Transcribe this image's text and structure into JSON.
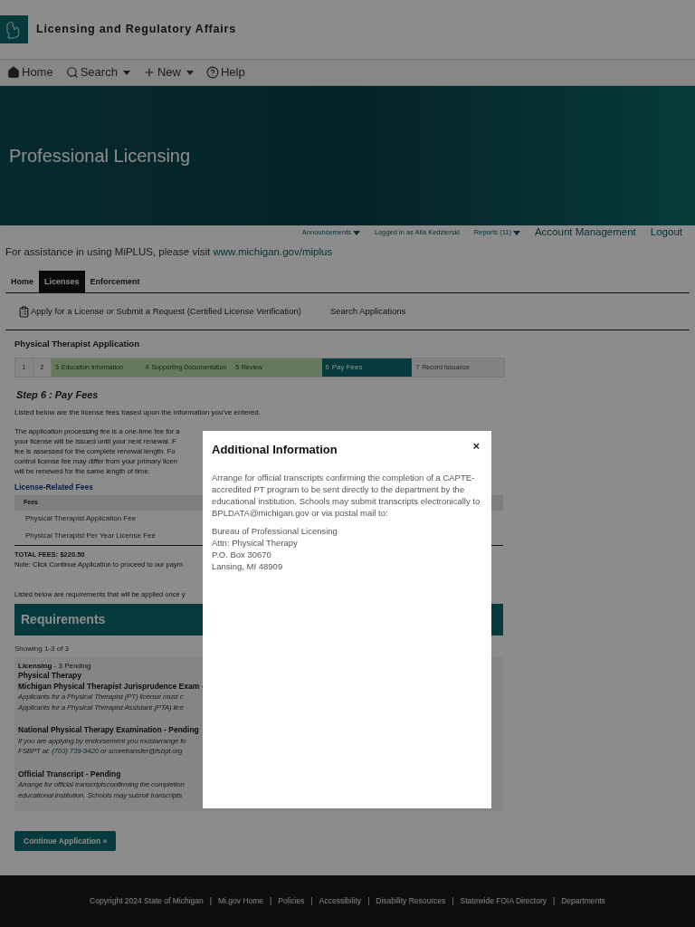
{
  "header": {
    "title": "Licensing and Regulatory Affairs"
  },
  "nav": [
    {
      "label": "Home",
      "kind": "home",
      "dropdown": false
    },
    {
      "label": "Search",
      "kind": "search",
      "dropdown": true
    },
    {
      "label": "New",
      "kind": "plus",
      "dropdown": true
    },
    {
      "label": "Help",
      "kind": "help",
      "dropdown": false
    }
  ],
  "banner": {
    "title": "Professional Licensing"
  },
  "utility_bar": [
    {
      "label": "Announcements",
      "kind": "small",
      "dropdown": true
    },
    {
      "label": "Logged in as Alla Kedzierski",
      "kind": "small",
      "dropdown": false
    },
    {
      "label": "Reports (11)",
      "kind": "small",
      "dropdown": true
    },
    {
      "label": "Account Management",
      "kind": "large",
      "dropdown": false
    },
    {
      "label": "Logout",
      "kind": "large",
      "dropdown": false
    }
  ],
  "assistance": {
    "text": "For assistance in using MiPLUS, please visit",
    "link": "www.michigan.gov/miplus"
  },
  "tabs": [
    {
      "label": "Home",
      "selected": false
    },
    {
      "label": "Licenses",
      "selected": true
    },
    {
      "label": "Enforcement",
      "selected": false
    }
  ],
  "submenu": [
    {
      "label": "Apply for a License or Submit a Request (Certified License Verification)",
      "kind": "clipboard"
    },
    {
      "label": "Search Applications",
      "kind": "plain"
    }
  ],
  "application": {
    "title": "Physical Therapist Application",
    "steps": [
      {
        "number": "1",
        "kind": "collapsed"
      },
      {
        "number": "2",
        "kind": "collapsed"
      },
      {
        "number": "3",
        "label": "Education Information",
        "kind": "done"
      },
      {
        "number": "4",
        "label": "Supporting Documentation",
        "kind": "done"
      },
      {
        "number": "5",
        "label": "Review",
        "kind": "done"
      },
      {
        "number": "6",
        "label": "Pay Fees",
        "kind": "current"
      },
      {
        "number": "7",
        "label": "Record Issuance",
        "kind": "upcoming"
      }
    ]
  },
  "step_heading": "Step 6 : Pay Fees",
  "fees_intro": "Listed below are the license fees based upon the information you've entered.",
  "fees_paragraph": [
    "The application processing fee is a one-time fee for a",
    "your license will be issued until your next renewal.  F",
    "fee is assessed for the complete renewal length.  Fo",
    "control license fee may differ from your primary licen",
    "will be renewed for the same length of time."
  ],
  "fees_table": {
    "title": "License-Related Fees",
    "columns": [
      "Fees"
    ],
    "rows": [
      [
        "Physical Therapist Application Fee"
      ],
      [
        "Physical Therapist Per Year License Fee"
      ]
    ]
  },
  "total": "TOTAL FEES: $220.50",
  "note": "Note: Click Continue Application to proceed to our paym",
  "requirements": {
    "intro": "Listed below are requirements that will be applied once y",
    "title": "Requirements",
    "showing": "Showing 1-3 of 3",
    "blocks": [
      [
        {
          "kind": "group",
          "text": "Licensing",
          "note": "- 3 Pending"
        },
        {
          "kind": "subhead",
          "text": "Physical Therapy"
        },
        {
          "kind": "item",
          "text": "Michigan Physical Therapist Jurisprudence Exam -"
        },
        {
          "kind": "desc",
          "text": "Applicants for a Physical Therapist (PT) license must c"
        },
        {
          "kind": "desc",
          "text": "Applicants for a Physical Therapist Assistant (PTA) lice"
        }
      ],
      [
        {
          "kind": "item",
          "text": "National Physical Therapy Examination - Pending"
        },
        {
          "kind": "desc",
          "text": "If you are applying by endorsement you mustarrange fo"
        },
        {
          "kind": "desc",
          "text": "FSBPT at:",
          "link": "(703) 739-9420",
          "after": "or scoretransfer@fsbpt.org"
        }
      ],
      [
        {
          "kind": "item",
          "text": "Official Transcript - Pending"
        },
        {
          "kind": "desc",
          "text": "Arrange for official transcriptsconfirming the completion"
        },
        {
          "kind": "desc",
          "text": "educational institution.  Schools may submit transcripts"
        }
      ]
    ]
  },
  "continue_button": "Continue Application »",
  "footer": {
    "separator": "|",
    "links": [
      "Copyright 2024 State of Michigan",
      "Mi.gov Home",
      "Policies",
      "Accessibility",
      "Disability Resources",
      "Statewide FOIA Directory",
      "Departments"
    ]
  },
  "modal": {
    "title": "Additional Information",
    "close": "×",
    "body": "Arrange for official transcripts confirming the completion of a CAPTE-accredited PT program to be sent directly to the department by the educational institution.  Schools may submit transcripts electronically to BPLDATA@michigan.gov or via postal mail to:",
    "address": [
      "Bureau of Professional Licensing",
      "Attn: Physical Therapy",
      "P.O. Box 30670",
      "Lansing, MI 48909"
    ]
  }
}
